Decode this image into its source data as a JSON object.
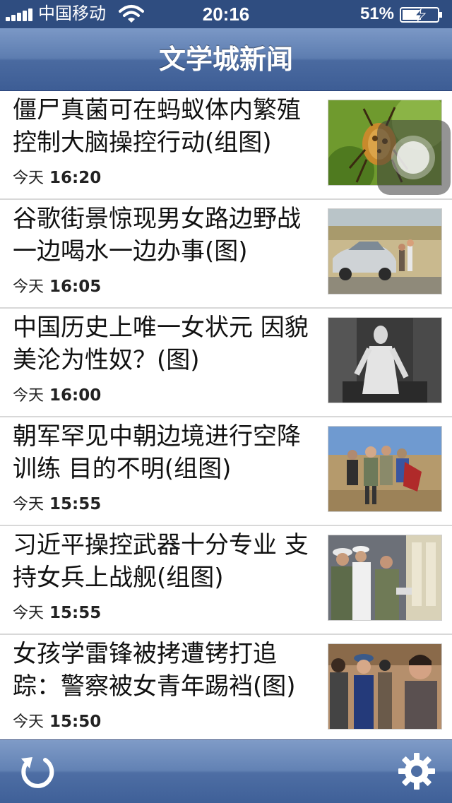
{
  "status_bar": {
    "carrier": "中国移动",
    "time": "20:16",
    "battery_percent": "51%",
    "signal_icon": "signal-bars-icon",
    "wifi_icon": "wifi-icon",
    "battery_icon": "battery-charging-icon"
  },
  "nav": {
    "title": "文学城新闻"
  },
  "news": [
    {
      "title": "僵尸真菌可在蚂蚁体内繁殖控制大脑操控行动(组图)",
      "day": "今天",
      "time": "16:20",
      "thumb": "ant-photo"
    },
    {
      "title": "谷歌街景惊现男女路边野战 一边喝水一边办事(图)",
      "day": "今天",
      "time": "16:05",
      "thumb": "street-car-photo"
    },
    {
      "title": "中国历史上唯一女状元 因貌美沦为性奴？(图)",
      "day": "今天",
      "time": "16:00",
      "thumb": "historical-woman-photo"
    },
    {
      "title": "朝军罕见中朝边境进行空降训练 目的不明(组图)",
      "day": "今天",
      "time": "15:55",
      "thumb": "soldiers-field-photo"
    },
    {
      "title": "习近平操控武器十分专业 支持女兵上战舰(组图)",
      "day": "今天",
      "time": "15:55",
      "thumb": "navy-officials-photo"
    },
    {
      "title": "女孩学雷锋被拷遭铐打追踪：警察被女青年踢裆(图)",
      "day": "今天",
      "time": "15:50",
      "thumb": "crowd-photo"
    }
  ],
  "toolbar": {
    "refresh_icon": "refresh-icon",
    "settings_icon": "gear-icon"
  },
  "colors": {
    "navbar": "#5d7db0",
    "status_bar": "#2f4d80",
    "row_divider": "#d8d8d8"
  }
}
